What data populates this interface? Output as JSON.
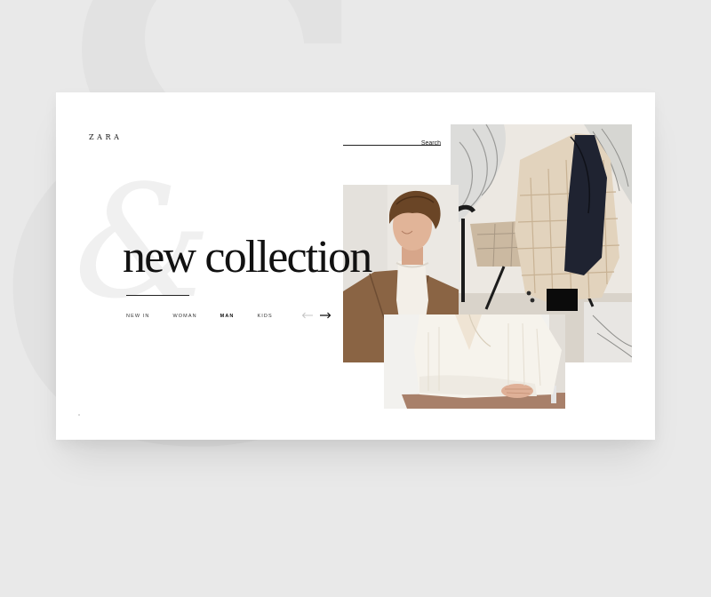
{
  "background": {
    "glyph": "&"
  },
  "header": {
    "logo": "ZARA",
    "search": {
      "placeholder": "Search",
      "value": ""
    }
  },
  "hero": {
    "decor_glyph": "&",
    "headline": "new collection"
  },
  "nav": {
    "items": [
      {
        "label": "NEW IN",
        "active": false
      },
      {
        "label": "WOMAN",
        "active": false
      },
      {
        "label": "MAN",
        "active": true
      },
      {
        "label": "KIDS",
        "active": false
      }
    ]
  },
  "carousel": {
    "prev_icon": "arrow-left-icon",
    "next_icon": "arrow-right-icon"
  },
  "photos": [
    {
      "name": "jacket-on-chair-photo"
    },
    {
      "name": "man-portrait-photo"
    },
    {
      "name": "sweater-detail-photo"
    }
  ],
  "colors": {
    "page_background": "#e9e9e9",
    "card": "#ffffff",
    "text": "#111111",
    "accent_block": "#0b0b0b"
  }
}
